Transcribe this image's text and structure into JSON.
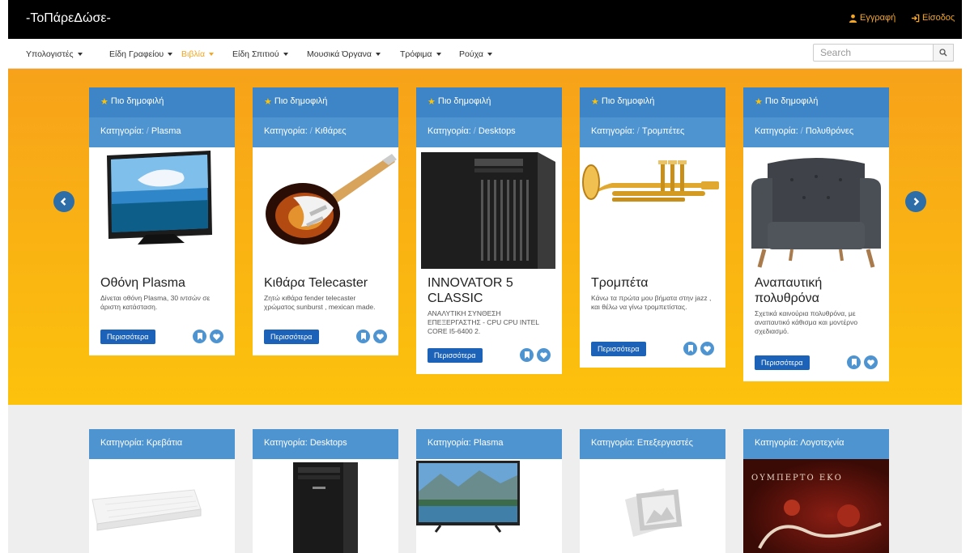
{
  "header": {
    "brand": "-ΤοΠάρεΔώσε-",
    "register": "Εγγραφή",
    "login": "Είσοδος"
  },
  "nav": {
    "items": [
      {
        "label": "Υπολογιστές"
      },
      {
        "label": "Είδη Γραφείου"
      },
      {
        "label": "Βιβλία"
      },
      {
        "label": "Είδη Σπιτιού"
      },
      {
        "label": "Μουσικά Όργανα"
      },
      {
        "label": "Τρόφιμα"
      },
      {
        "label": "Ρούχα"
      }
    ],
    "active_index": 2,
    "search_placeholder": "Search"
  },
  "featured": {
    "popular_label": "Πιο δημοφιλή",
    "category_prefix": "Κατηγορία:",
    "more_label": "Περισσότερα",
    "cards": [
      {
        "category": "Plasma",
        "title": "Οθόνη Plasma",
        "desc": "Δίνεται οθόνη Plasma, 30 ιντσών σε άριστη κατάσταση."
      },
      {
        "category": "Κιθάρες",
        "title": "Κιθάρα Telecaster",
        "desc": "Ζητώ κιθάρα fender telecaster χρώματος sunburst , mexican made."
      },
      {
        "category": "Desktops",
        "title": "INNOVATOR 5 CLASSIC",
        "desc": "ΑΝΑΛΥΤΙΚΗ ΣΥΝΘΕΣΗ ΕΠΕΞΕΡΓΑΣΤΗΣ - CPU CPU INTEL CORE I5-6400 2."
      },
      {
        "category": "Τρομπέτες",
        "title": "Τρομπέτα",
        "desc": "Κάνω τα πρώτα μου βήματα στην jazz , και θέλω να γίνω τρομπετίστας."
      },
      {
        "category": "Πολυθρόνες",
        "title": "Αναπαυτική πολυθρόνα",
        "desc": "Σχετικά καινούρια πολυθρόνα, με αναπαυτικό κάθισμα και μοντέρνο σχεδιασμό."
      }
    ]
  },
  "recent": {
    "cards": [
      {
        "header": "Κατηγορία: Κρεβάτια"
      },
      {
        "header": "Κατηγορία: Desktops"
      },
      {
        "header": "Κατηγορία: Plasma"
      },
      {
        "header": "Κατηγορία: Επεξεργαστές"
      },
      {
        "header": "Κατηγορία: Λογοτεχνία"
      }
    ],
    "book_cover_text": "ΟΥΜΠΕΡΤΟ ΕΚΟ"
  },
  "colors": {
    "accent": "#f5a623",
    "header_blue": "#3d85c6",
    "button_blue": "#1b62b8"
  }
}
